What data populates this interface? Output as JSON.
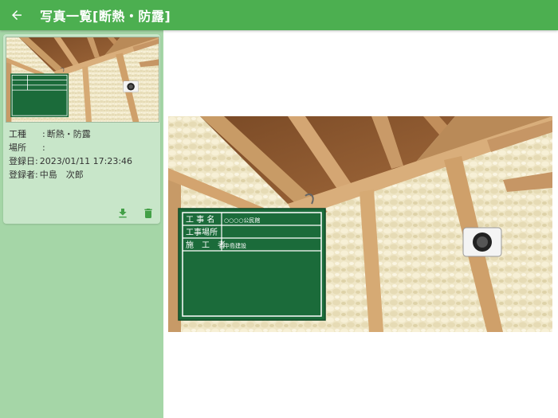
{
  "header": {
    "back_icon": "arrow-left-icon",
    "title": "写真一覧[断熱・防露]",
    "color": "#4caf50"
  },
  "sidebar": {
    "background": "#a5d6a7",
    "card": {
      "rows": [
        {
          "key": "工種",
          "value": "断熱・防露"
        },
        {
          "key": "場所",
          "value": ""
        },
        {
          "key": "登録日",
          "value": "2023/01/11 17:23:46"
        },
        {
          "key": "登録者",
          "value": "中島　次郎"
        }
      ],
      "download_icon": "download-icon",
      "delete_icon": "trash-icon",
      "accent": "#4caf50"
    }
  },
  "photo": {
    "board": {
      "row1_label": "工 事 名",
      "row1_value": "○○○○公民館",
      "row2_label": "工事場所",
      "row2_value": "",
      "row3_label": "施　工　者",
      "row3_value": "中島建設",
      "color": "#1b6b3a"
    }
  }
}
